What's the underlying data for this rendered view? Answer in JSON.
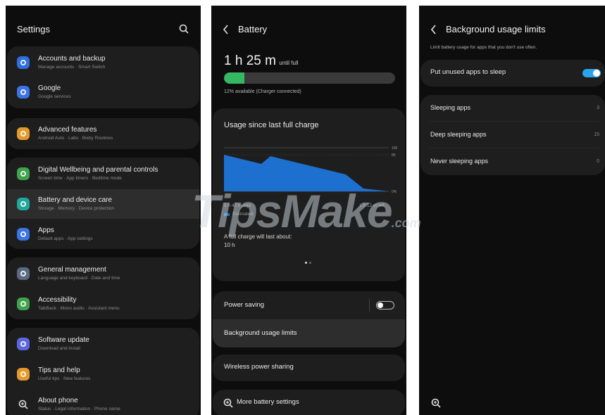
{
  "settings": {
    "title": "Settings",
    "items": [
      {
        "title": "Accounts and backup",
        "subtitle": "Manage accounts  ·  Smart Switch",
        "color": "#2f6fe0"
      },
      {
        "title": "Google",
        "subtitle": "Google services",
        "color": "#3b74e6"
      },
      {
        "title": "Advanced features",
        "subtitle": "Android Auto  ·  Labs  ·  Bixby Routines",
        "color": "#e39a2b"
      },
      {
        "title": "Digital Wellbeing and parental controls",
        "subtitle": "Screen time  ·  App timers  ·  Bedtime mode",
        "color": "#3fa34d"
      },
      {
        "title": "Battery and device care",
        "subtitle": "Storage  ·  Memory  ·  Device protection",
        "color": "#21a89a"
      },
      {
        "title": "Apps",
        "subtitle": "Default apps  ·  App settings",
        "color": "#3b74e6"
      },
      {
        "title": "General management",
        "subtitle": "Language and keyboard  ·  Date and time",
        "color": "#5a6a80"
      },
      {
        "title": "Accessibility",
        "subtitle": "TalkBack  ·  Mono audio  ·  Assistant menu",
        "color": "#3fa34d"
      },
      {
        "title": "Software update",
        "subtitle": "Download and install",
        "color": "#5b67e0"
      },
      {
        "title": "Tips and help",
        "subtitle": "Useful tips  ·  New features",
        "color": "#e39a2b"
      },
      {
        "title": "About phone",
        "subtitle": "Status  ·  Legal information  ·  Phone name",
        "color": "#555555"
      }
    ]
  },
  "battery": {
    "title": "Battery",
    "time_remaining": "1 h 25 m",
    "time_suffix": "until full",
    "level_fraction": 0.12,
    "status": "12% available (Charger connected)",
    "usage_title": "Usage since last full charge",
    "axis_labels": [
      "100",
      "85",
      "0%"
    ],
    "time_left_label": "5 h 42 m ago",
    "time_right_label": "1 h 12 m left",
    "legend": "Estimated",
    "full_charge_label": "A full charge will last about:",
    "full_charge_value": "10 h",
    "power_saving": "Power saving",
    "power_saving_on": false,
    "background_limits": "Background usage limits",
    "wireless_sharing": "Wireless power sharing",
    "more_settings": "More battery settings",
    "bar_color": "#35b864",
    "chart_color": "#1d6fd0"
  },
  "background_limits": {
    "title": "Background usage limits",
    "description": "Limit battery usage for apps that you don't use often.",
    "put_to_sleep": "Put unused apps to sleep",
    "put_to_sleep_on": true,
    "items": [
      {
        "label": "Sleeping apps",
        "count": "3"
      },
      {
        "label": "Deep sleeping apps",
        "count": "15"
      },
      {
        "label": "Never sleeping apps",
        "count": "0"
      }
    ],
    "accent": "#2aa3e8"
  },
  "watermark": "TipsMake",
  "watermark_suffix": ".com"
}
